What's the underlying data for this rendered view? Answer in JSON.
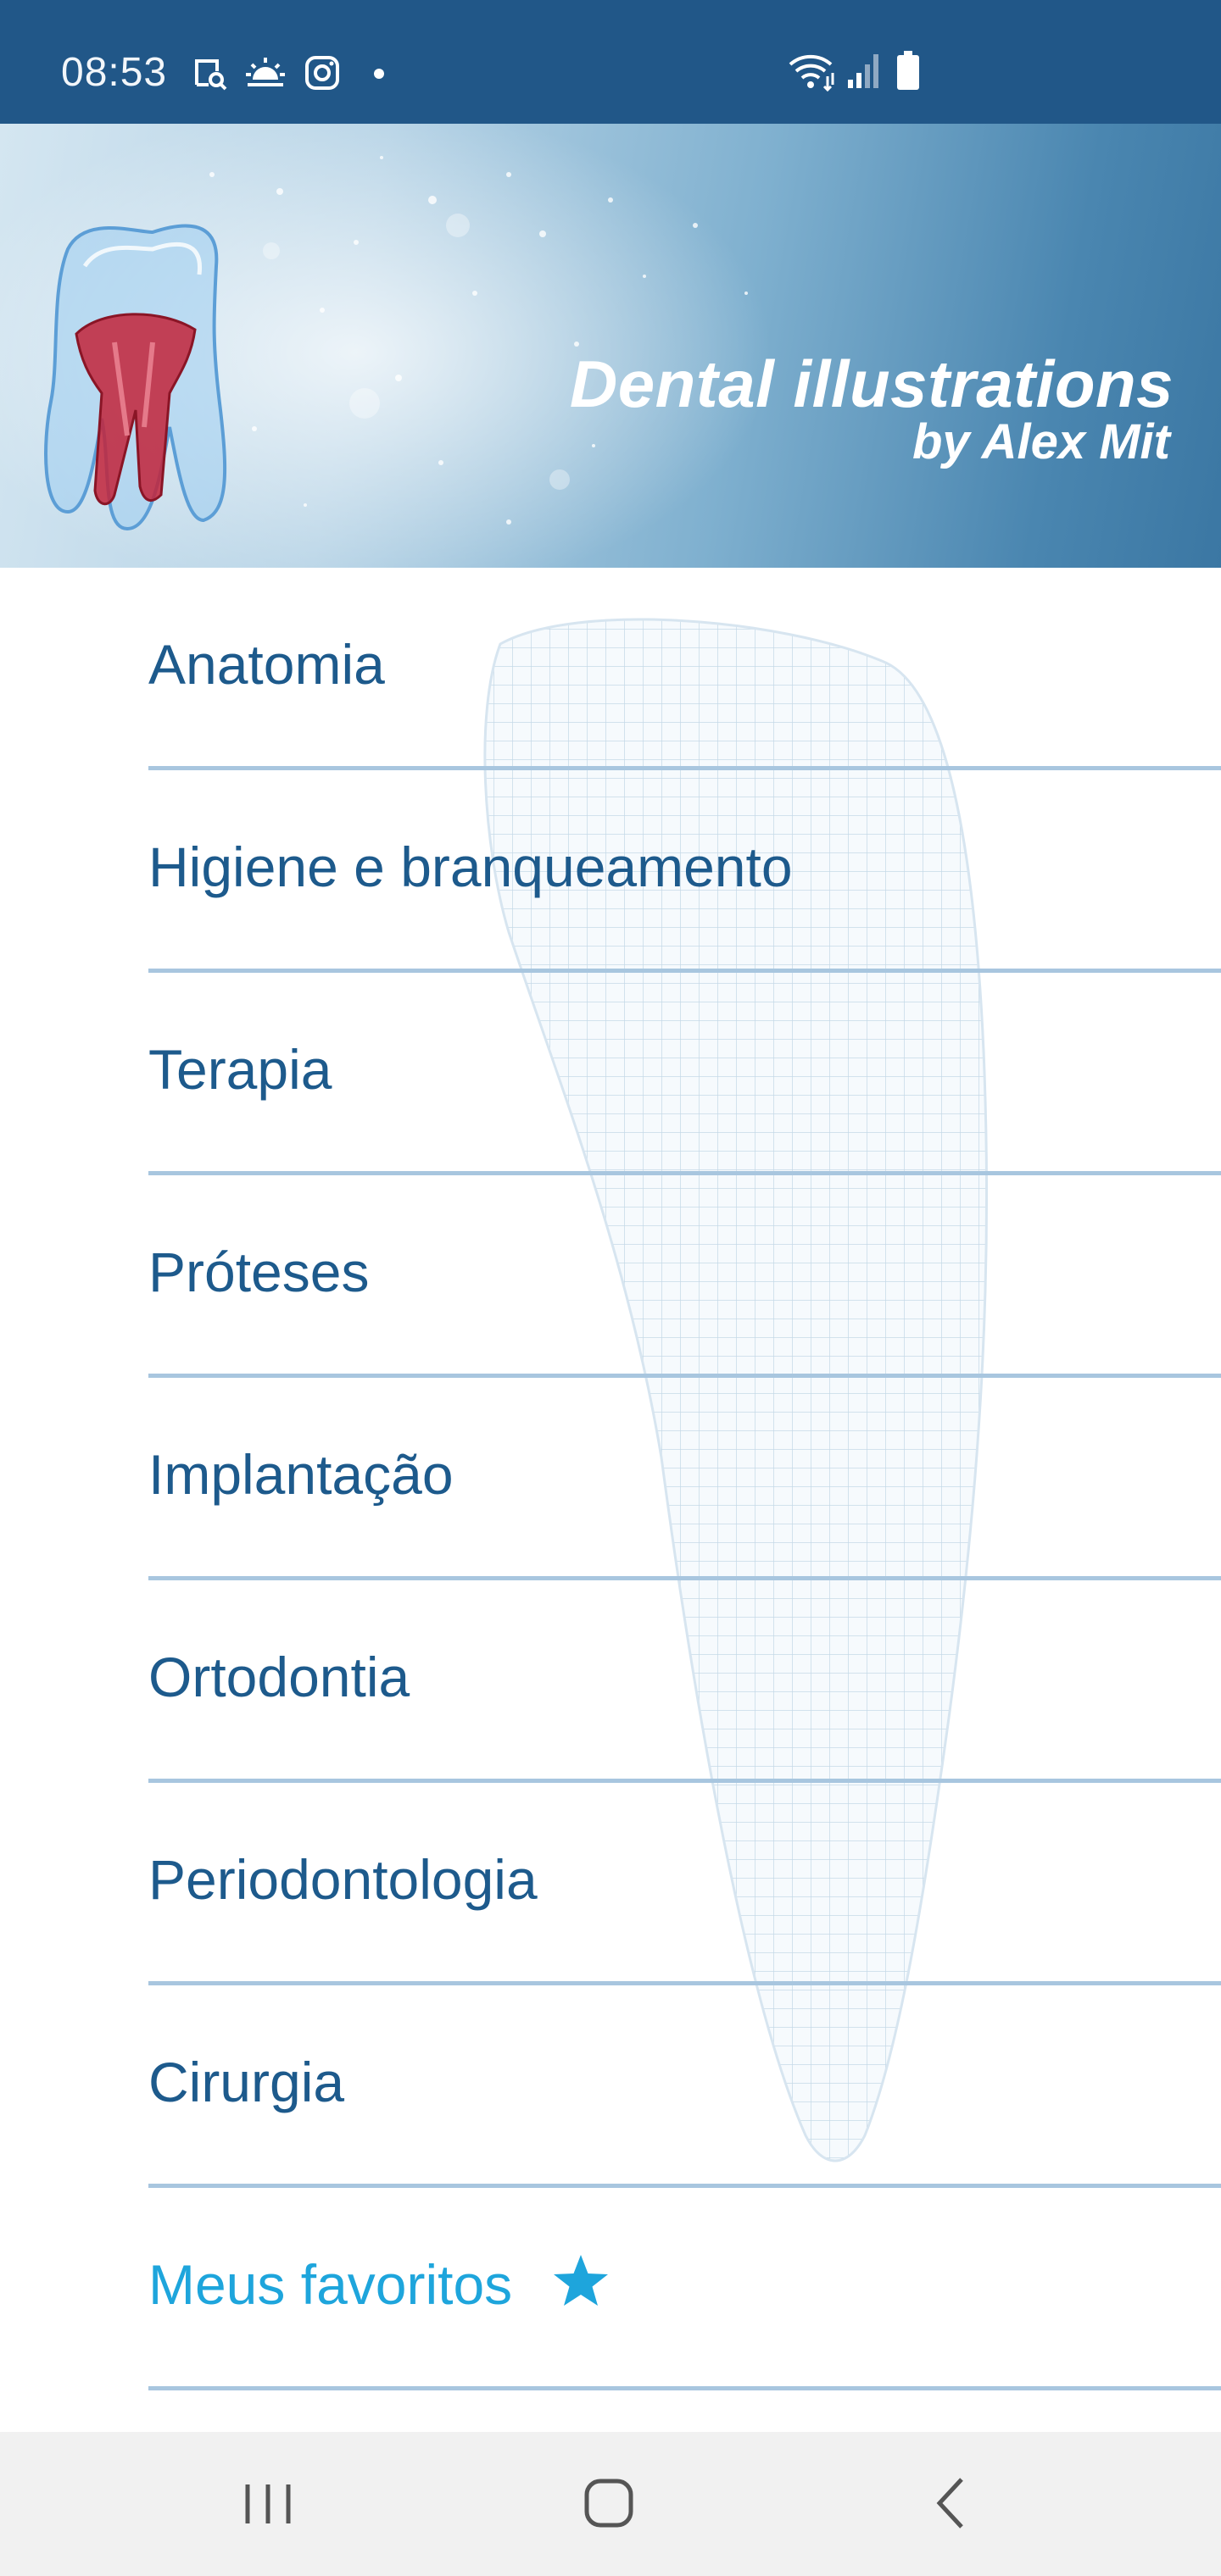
{
  "status_bar": {
    "time": "08:53",
    "left_icons": [
      "screenshot-icon",
      "weather-sunrise-icon",
      "instagram-icon",
      "notification-dot-icon"
    ],
    "right_icons": [
      "wifi-icon",
      "signal-icon",
      "battery-icon"
    ]
  },
  "header": {
    "title": "Dental illustrations",
    "subtitle": "by Alex Mit"
  },
  "menu": {
    "items": [
      {
        "label": "Anatomia"
      },
      {
        "label": "Higiene e branqueamento"
      },
      {
        "label": "Terapia"
      },
      {
        "label": "Próteses"
      },
      {
        "label": "Implantação"
      },
      {
        "label": "Ortodontia"
      },
      {
        "label": "Periodontologia"
      },
      {
        "label": "Cirurgia"
      }
    ],
    "favorites": {
      "label": "Meus favoritos",
      "icon": "star-icon"
    }
  },
  "nav_bar": {
    "buttons": [
      "recent-apps-icon",
      "home-icon",
      "back-icon"
    ]
  },
  "colors": {
    "status_bar": "#215788",
    "menu_text": "#1d5a8c",
    "favorites_text": "#1ea5dc",
    "divider": "#a8c6df",
    "nav_bar": "#f1f1f1"
  }
}
